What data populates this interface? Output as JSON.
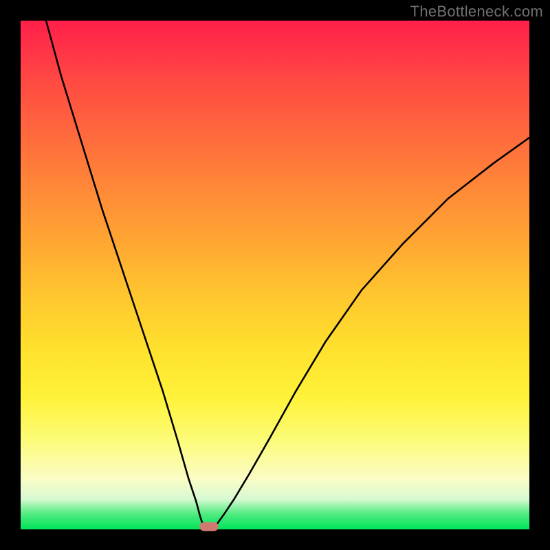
{
  "watermark": "TheBottleneck.com",
  "colors": {
    "frame": "#000000",
    "watermark": "#707070",
    "curve": "#000000",
    "marker": "#cf7a70",
    "gradient_stops": [
      {
        "pos": 0,
        "hex": "#ff1f4b"
      },
      {
        "pos": 12,
        "hex": "#ff4a42"
      },
      {
        "pos": 28,
        "hex": "#ff7a3a"
      },
      {
        "pos": 42,
        "hex": "#ffa233"
      },
      {
        "pos": 55,
        "hex": "#ffc92f"
      },
      {
        "pos": 65,
        "hex": "#ffe22d"
      },
      {
        "pos": 74,
        "hex": "#fff23a"
      },
      {
        "pos": 82,
        "hex": "#fcfb74"
      },
      {
        "pos": 90,
        "hex": "#fbfcc6"
      },
      {
        "pos": 94,
        "hex": "#d8fad2"
      },
      {
        "pos": 97,
        "hex": "#4feb7f"
      },
      {
        "pos": 100,
        "hex": "#00e35a"
      }
    ]
  },
  "chart_data": {
    "type": "line",
    "title": "",
    "xlabel": "",
    "ylabel": "",
    "xlim": [
      0,
      100
    ],
    "ylim": [
      0,
      100
    ],
    "series": [
      {
        "name": "left-branch",
        "x": [
          5,
          8,
          12,
          16,
          20,
          24,
          28,
          31,
          33,
          34.5,
          35.3,
          35.8,
          36
        ],
        "y": [
          100,
          89,
          76,
          63,
          51,
          39,
          27,
          17,
          10,
          5.5,
          2.5,
          1,
          0.5
        ]
      },
      {
        "name": "right-branch",
        "x": [
          38,
          38.7,
          40,
          42,
          45,
          49,
          54,
          60,
          67,
          75,
          84,
          93,
          100
        ],
        "y": [
          0.5,
          1.2,
          3,
          6,
          11,
          18,
          27,
          37,
          47,
          56,
          65,
          72,
          77
        ]
      }
    ],
    "marker": {
      "x": 37,
      "y": 0.5
    },
    "notes": "V-shaped bottleneck curve over a vertical rainbow heat gradient; cusp/minimum marked by a small salmon pill near the bottom. No numeric axis ticks are rendered in the source image; values are estimated from geometry on a 0–100 normalized grid."
  }
}
